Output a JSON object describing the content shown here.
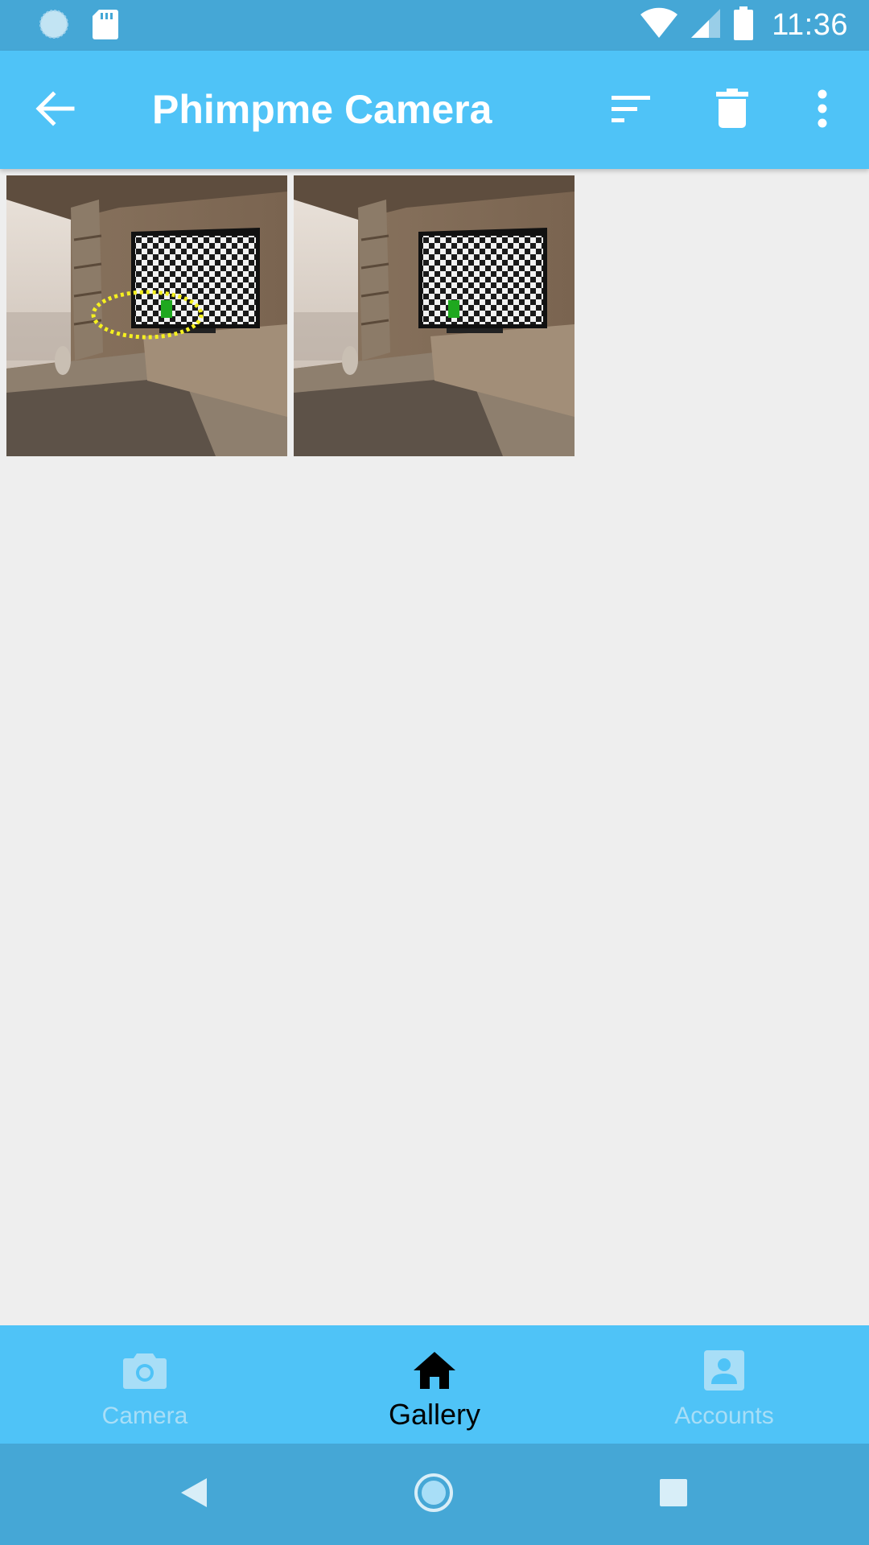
{
  "status_bar": {
    "time": "11:36",
    "icons": [
      "sync-icon",
      "sd-card-icon",
      "wifi-icon",
      "cell-signal-icon",
      "battery-icon"
    ]
  },
  "app_bar": {
    "title": "Phimpme Camera",
    "back_icon": "arrow-back-icon",
    "actions": [
      "sort-icon",
      "delete-icon",
      "more-vert-icon"
    ]
  },
  "gallery": {
    "items": [
      {
        "name": "photo-1",
        "annotated": true
      },
      {
        "name": "photo-2",
        "annotated": false
      }
    ]
  },
  "bottom_nav": {
    "items": [
      {
        "label": "Camera",
        "icon": "camera-icon",
        "active": false
      },
      {
        "label": "Gallery",
        "icon": "home-icon",
        "active": true
      },
      {
        "label": "Accounts",
        "icon": "account-box-icon",
        "active": false
      }
    ]
  },
  "system_nav": {
    "buttons": [
      "back-triangle-icon",
      "home-circle-icon",
      "recents-square-icon"
    ]
  },
  "colors": {
    "status_bar": "#45A7D6",
    "app_bar": "#4FC3F7",
    "background": "#EEEEEE",
    "nav_inactive": "#A8DEF7",
    "nav_active": "#000000",
    "annotation": "#F5F020",
    "tv_marker": "#1FA81F"
  }
}
